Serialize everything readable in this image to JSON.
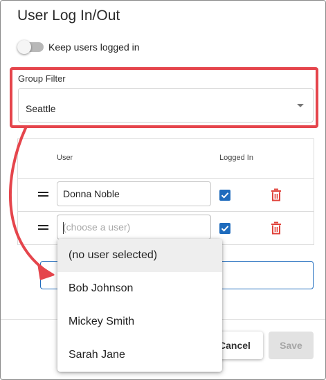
{
  "dialog": {
    "title": "User Log In/Out",
    "keep_logged_in": {
      "label": "Keep users logged in",
      "checked": false
    }
  },
  "group_filter": {
    "label": "Group Filter",
    "value": "Seattle"
  },
  "table": {
    "headers": {
      "user": "User",
      "logged_in": "Logged In"
    },
    "rows": [
      {
        "user": "Donna Noble",
        "placeholder": "",
        "logged_in": true
      },
      {
        "user": "",
        "placeholder": "(choose a user)",
        "logged_in": true
      }
    ]
  },
  "dropdown": {
    "options": [
      "(no user selected)",
      "Bob Johnson",
      "Mickey Smith",
      "Sarah Jane"
    ],
    "highlighted_index": 0
  },
  "footer": {
    "cancel_label": "Cancel",
    "save_label": "Save"
  },
  "colors": {
    "accent": "#1e6bbd",
    "annotation": "#e5454c",
    "delete": "#e0423a"
  },
  "icons": [
    "drag-handle-icon",
    "checkbox-checked-icon",
    "trash-icon",
    "chevron-down-icon",
    "annotation-arrow"
  ]
}
